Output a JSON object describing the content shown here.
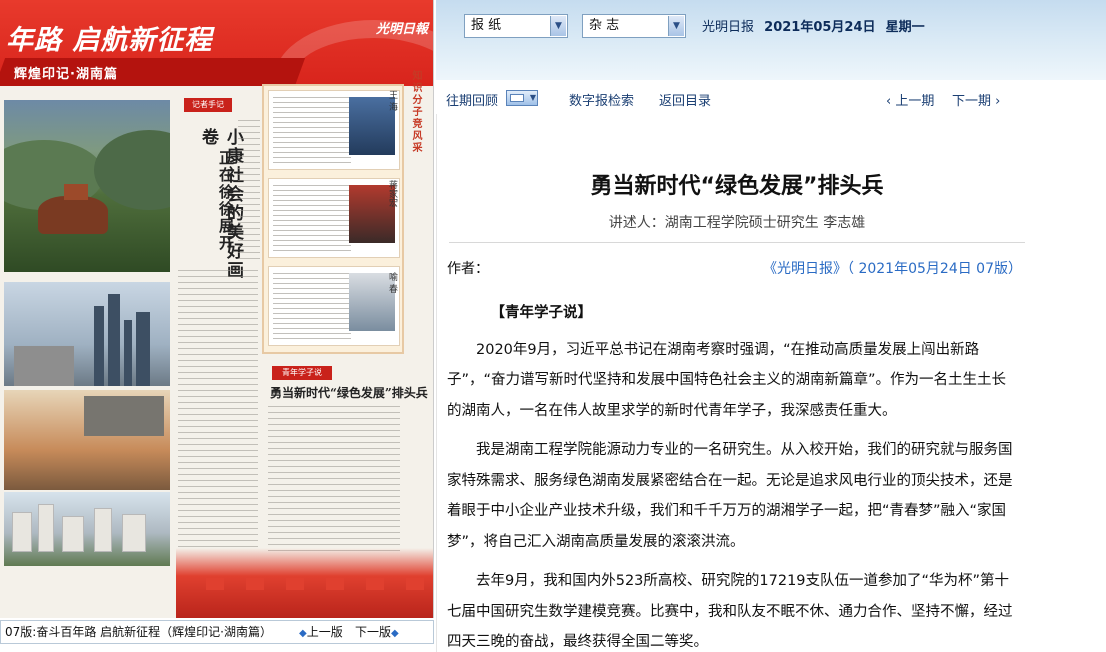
{
  "paper_page": {
    "banner_headline": "年路  启航新征程",
    "banner_sub": "辉煌印记·湖南篇",
    "masthead": "光明日報",
    "section_tag": "记者手记",
    "feature_title_1": "小康社会的美好画卷",
    "feature_title_2": "正在徐徐展开",
    "side_label": "知识分子竞风采",
    "figure_names": [
      "王 海",
      "蒋家宏",
      "喻 春"
    ],
    "article_tag": "青年学子说",
    "article_title": "勇当新时代“绿色发展”排头兵"
  },
  "pagebar": {
    "page_name": "07版:奋斗百年路 启航新征程（辉煌印记·湖南篇）",
    "prev_label": "上一版",
    "next_label": "下一版"
  },
  "topbar": {
    "select_paper": "报 纸",
    "select_magazine": "杂 志",
    "publication": "光明日报",
    "date": "2021年05月24日",
    "weekday": "星期一"
  },
  "toolbar": {
    "back_issues": "往期回顾",
    "digital_search": "数字报检索",
    "back_to_contents": "返回目录",
    "prev_issue": "上一期",
    "next_issue": "下一期"
  },
  "article": {
    "title": "勇当新时代“绿色发展”排头兵",
    "subtitle": "讲述人：湖南工程学院硕士研究生 李志雄",
    "author_label": "作者：",
    "source": "《光明日报》（ 2021年05月24日  07版）",
    "lead": "【青年学子说】",
    "paragraphs": [
      "2020年9月，习近平总书记在湖南考察时强调，“在推动高质量发展上闯出新路子”，“奋力谱写新时代坚持和发展中国特色社会主义的湖南新篇章”。作为一名土生土长的湖南人，一名在伟人故里求学的新时代青年学子，我深感责任重大。",
      "我是湖南工程学院能源动力专业的一名研究生。从入校开始，我们的研究就与服务国家特殊需求、服务绿色湖南发展紧密结合在一起。无论是追求风电行业的顶尖技术，还是着眼于中小企业产业技术升级，我们和千千万万的湖湘学子一起，把“青春梦”融入“家国梦”，将自己汇入湖南高质量发展的滚滚洪流。",
      "去年9月，我和国内外523所高校、研究院的17219支队伍一道参加了“华为杯”第十七届中国研究生数学建模竞赛。比赛中，我和队友不眠不休、通力合作、坚持不懈，经过四天三晚的奋战，最终获得全国二等奖。"
    ]
  },
  "colors": {
    "banner_red": "#d8241c",
    "link_blue": "#2a6bc4",
    "nav_dark_blue": "#1b3f73"
  }
}
